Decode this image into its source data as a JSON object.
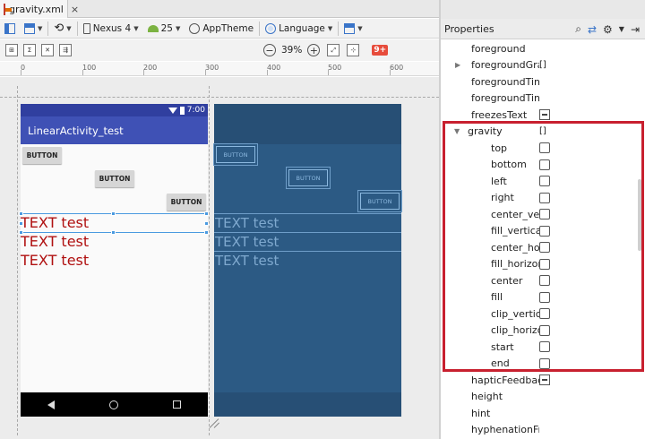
{
  "tab": {
    "filename": "gravity.xml",
    "close": "×"
  },
  "toolbar": {
    "device": "Nexus 4",
    "api": "25",
    "theme": "AppTheme",
    "language": "Language",
    "zoom": "39%",
    "warnings_badge": "9+"
  },
  "ruler": {
    "labels": [
      "0",
      "100",
      "200",
      "300",
      "400",
      "500",
      "600"
    ]
  },
  "design": {
    "status_time": "7:00",
    "app_title": "LinearActivity_test",
    "buttons": [
      "BUTTON",
      "BUTTON",
      "BUTTON"
    ],
    "texts": [
      "TEXT test",
      "TEXT test",
      "TEXT test"
    ]
  },
  "blueprint": {
    "buttons": [
      "BUTTON",
      "BUTTON",
      "BUTTON"
    ],
    "texts": [
      "TEXT test",
      "TEXT test",
      "TEXT test"
    ]
  },
  "properties": {
    "title": "Properties",
    "rows": [
      {
        "name": "foreground",
        "value": ""
      },
      {
        "name": "foregroundGravi",
        "value": "[]"
      },
      {
        "name": "foregroundTint",
        "value": ""
      },
      {
        "name": "foregroundTintM",
        "value": ""
      },
      {
        "name": "freezesText",
        "value": ""
      },
      {
        "name": "gravity",
        "value": "[]"
      },
      {
        "name": "top",
        "value": ""
      },
      {
        "name": "bottom",
        "value": ""
      },
      {
        "name": "left",
        "value": ""
      },
      {
        "name": "right",
        "value": ""
      },
      {
        "name": "center_verti",
        "value": ""
      },
      {
        "name": "fill_vertical",
        "value": ""
      },
      {
        "name": "center_horiz",
        "value": ""
      },
      {
        "name": "fill_horizont",
        "value": ""
      },
      {
        "name": "center",
        "value": ""
      },
      {
        "name": "fill",
        "value": ""
      },
      {
        "name": "clip_vertical",
        "value": ""
      },
      {
        "name": "clip_horizon",
        "value": ""
      },
      {
        "name": "start",
        "value": ""
      },
      {
        "name": "end",
        "value": ""
      },
      {
        "name": "hapticFeedbackE",
        "value": ""
      },
      {
        "name": "height",
        "value": ""
      },
      {
        "name": "hint",
        "value": ""
      },
      {
        "name": "hyphenationFreq",
        "value": ""
      }
    ]
  },
  "colors": {
    "highlight": "#c8202f",
    "appbar": "#3f51b5",
    "blueprint": "#2c5a84",
    "text_red": "#b01010"
  }
}
